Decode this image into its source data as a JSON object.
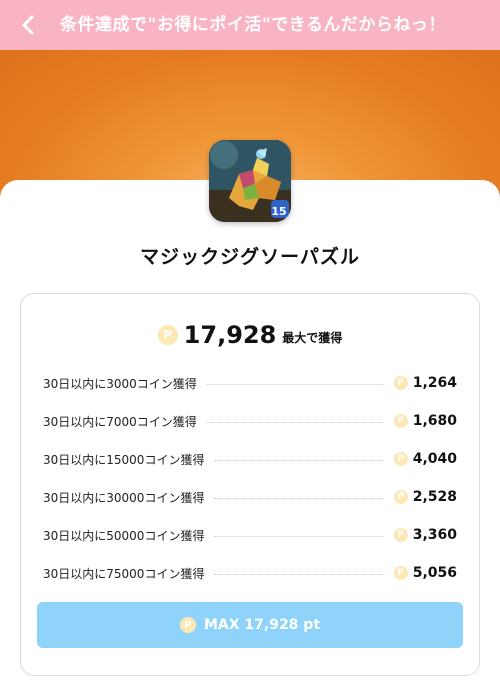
{
  "header": {
    "title": "条件達成で\"お得にポイ活\"できるんだからねっ！",
    "back_icon": "chevron-left-icon",
    "background_color": "#f9b4c4"
  },
  "hero": {
    "background_color": "#e88428"
  },
  "app": {
    "name": "マジックジグソーパズル",
    "icon": "puzzle-app-icon",
    "icon_badge": "15"
  },
  "reward": {
    "coin_symbol": "P",
    "total_value": "17,928",
    "total_suffix": "最大で獲得",
    "tiers": [
      {
        "label": "30日以内に3000コイン獲得",
        "value": "1,264"
      },
      {
        "label": "30日以内に7000コイン獲得",
        "value": "1,680"
      },
      {
        "label": "30日以内に15000コイン獲得",
        "value": "4,040"
      },
      {
        "label": "30日以内に30000コイン獲得",
        "value": "2,528"
      },
      {
        "label": "30日以内に50000コイン獲得",
        "value": "3,360"
      },
      {
        "label": "30日以内に75000コイン獲得",
        "value": "5,056"
      }
    ],
    "button_label": "MAX 17,928 pt",
    "button_color": "#8fd3fb",
    "coin_color": "#fde8b4"
  }
}
